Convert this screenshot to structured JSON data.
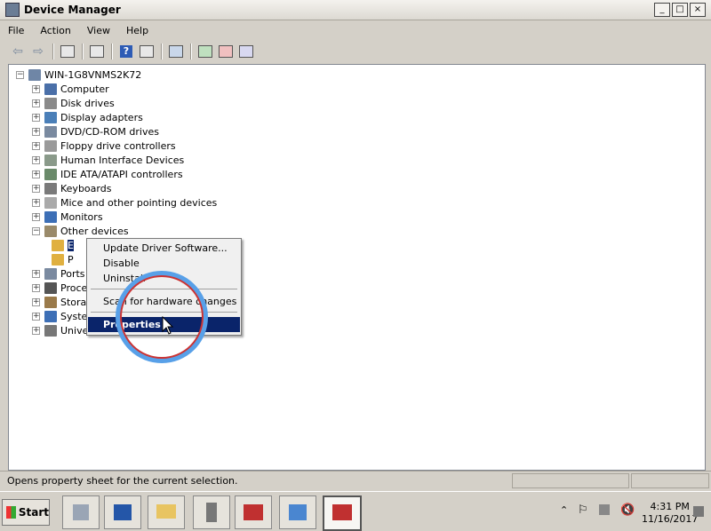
{
  "window": {
    "title": "Device Manager",
    "controls": [
      "_",
      "□",
      "×"
    ]
  },
  "menubar": {
    "items": [
      "File",
      "Action",
      "View",
      "Help"
    ]
  },
  "tree": {
    "root": "WIN-1G8VNMS2K72",
    "nodes": [
      {
        "label": "Computer",
        "icon": "computer-icon"
      },
      {
        "label": "Disk drives",
        "icon": "disk-drive-icon"
      },
      {
        "label": "Display adapters",
        "icon": "display-adapter-icon"
      },
      {
        "label": "DVD/CD-ROM drives",
        "icon": "dvd-drive-icon"
      },
      {
        "label": "Floppy drive controllers",
        "icon": "floppy-controller-icon"
      },
      {
        "label": "Human Interface Devices",
        "icon": "hid-icon"
      },
      {
        "label": "IDE ATA/ATAPI controllers",
        "icon": "ide-controller-icon"
      },
      {
        "label": "Keyboards",
        "icon": "keyboard-icon"
      },
      {
        "label": "Mice and other pointing devices",
        "icon": "mouse-icon"
      },
      {
        "label": "Monitors",
        "icon": "monitor-icon"
      },
      {
        "label": "Other devices",
        "icon": "other-devices-icon"
      },
      {
        "label": "E",
        "icon": "warning-device-icon"
      },
      {
        "label": "P",
        "icon": "warning-device-icon"
      },
      {
        "label": "Ports",
        "icon": "ports-icon"
      },
      {
        "label": "Proce",
        "icon": "processor-icon"
      },
      {
        "label": "Stora",
        "icon": "storage-icon"
      },
      {
        "label": "Syste",
        "icon": "system-devices-icon"
      },
      {
        "label": "Unive",
        "icon": "usb-icon"
      }
    ]
  },
  "context_menu": {
    "items": [
      "Update Driver Software...",
      "Disable",
      "Uninstall",
      "Scan for hardware changes",
      "Properties"
    ],
    "selected": "Properties"
  },
  "statusbar": {
    "text": "Opens property sheet for the current selection."
  },
  "taskbar": {
    "start_label": "Start",
    "clock_time": "4:31 PM",
    "clock_date": "11/16/2017"
  }
}
